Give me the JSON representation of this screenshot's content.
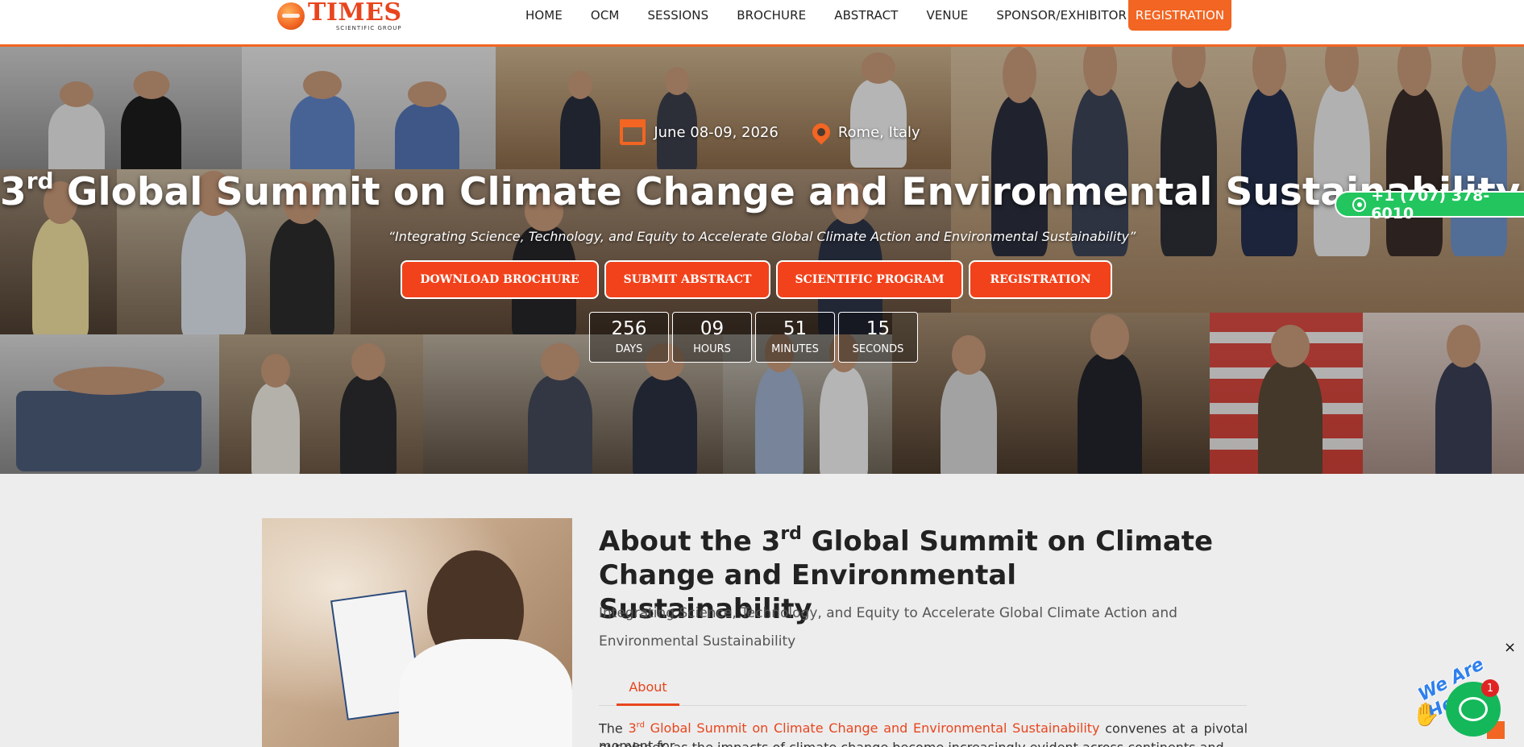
{
  "header": {
    "logo_main": "TIMES",
    "logo_sub": "SCIENTIFIC GROUP",
    "nav": [
      {
        "label": "HOME"
      },
      {
        "label": "OCM"
      },
      {
        "label": "SESSIONS"
      },
      {
        "label": "BROCHURE"
      },
      {
        "label": "ABSTRACT"
      },
      {
        "label": "VENUE"
      },
      {
        "label": "SPONSOR/EXHIBITOR"
      }
    ],
    "register_label": "REGISTRATION"
  },
  "hero": {
    "date": "June 08-09, 2026",
    "location": "Rome, Italy",
    "title_ordinal": "3",
    "title_suffix": "rd",
    "title_rest": " Global Summit on Climate Change and Environmental Sustainability",
    "tagline": "“Integrating Science, Technology, and Equity to Accelerate Global Climate Action and Environmental Sustainability”",
    "buttons": [
      {
        "label": "DOWNLOAD BROCHURE"
      },
      {
        "label": "SUBMIT ABSTRACT"
      },
      {
        "label": "SCIENTIFIC PROGRAM"
      },
      {
        "label": "REGISTRATION"
      }
    ],
    "countdown": [
      {
        "value": "256",
        "label": "DAYS"
      },
      {
        "value": "09",
        "label": "HOURS"
      },
      {
        "value": "51",
        "label": "MINUTES"
      },
      {
        "value": "15",
        "label": "SECONDS"
      }
    ],
    "phone": "+1 (707) 378-6010"
  },
  "about": {
    "title_prefix": "About the 3",
    "title_suffix": "rd",
    "title_rest": " Global Summit on Climate Change and Environmental Sustainability",
    "subtitle": "Integrating Science, Technology, and Equity to Accelerate Global Climate Action and Environmental Sustainability",
    "tab_label": "About",
    "body_prefix": "The ",
    "body_link_ordinal": "3",
    "body_link_suffix": "rd",
    "body_link_rest": " Global Summit on Climate Change and Environmental Sustainability",
    "body_rest": " convenes at a pivotal moment for",
    "body_line2": "our planet, as the impacts of climate change become increasingly evident across continents and sectors. This"
  },
  "chat": {
    "tagline": "We Are Here!",
    "badge": "1",
    "close": "×"
  },
  "colors": {
    "accent": "#f26522",
    "button": "#f2421b",
    "whatsapp": "#22c55e",
    "chat": "#14b85a"
  },
  "icons": {
    "date": "calendar-icon",
    "location": "map-pin-icon",
    "phone": "whatsapp-icon",
    "chat": "chat-bubble-icon"
  }
}
